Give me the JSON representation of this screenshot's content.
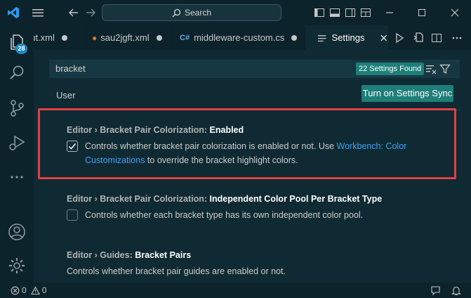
{
  "titlebar": {
    "search_label": "Search"
  },
  "activity": {
    "explorer_badge": "28"
  },
  "tabs": [
    {
      "label": "out.xml"
    },
    {
      "label": "sau2jgft.xml"
    },
    {
      "label": "middleware-custom.cs"
    },
    {
      "label": "Settings"
    }
  ],
  "settings": {
    "search_value": "bracket",
    "found_label": "22 Settings Found",
    "scope_tab": "User",
    "sync_button": "Turn on Settings Sync",
    "items": [
      {
        "category": "Editor › Bracket Pair Colorization: ",
        "name": "Enabled",
        "checked": true,
        "desc_before": "Controls whether bracket pair colorization is enabled or not. Use ",
        "link": "Workbench: Color Customizations",
        "desc_after": " to override the bracket highlight colors."
      },
      {
        "category": "Editor › Bracket Pair Colorization: ",
        "name": "Independent Color Pool Per Bracket Type",
        "checked": false,
        "desc": "Controls whether each bracket type has its own independent color pool."
      },
      {
        "category": "Editor › Guides: ",
        "name": "Bracket Pairs",
        "desc": "Controls whether bracket pair guides are enabled or not."
      }
    ]
  },
  "statusbar": {
    "errors": "0",
    "warnings": "0"
  },
  "colors": {
    "accent": "#1f7e7a",
    "link": "#3fa0f0",
    "highlight": "#e04147",
    "background": "#0f2a33"
  }
}
